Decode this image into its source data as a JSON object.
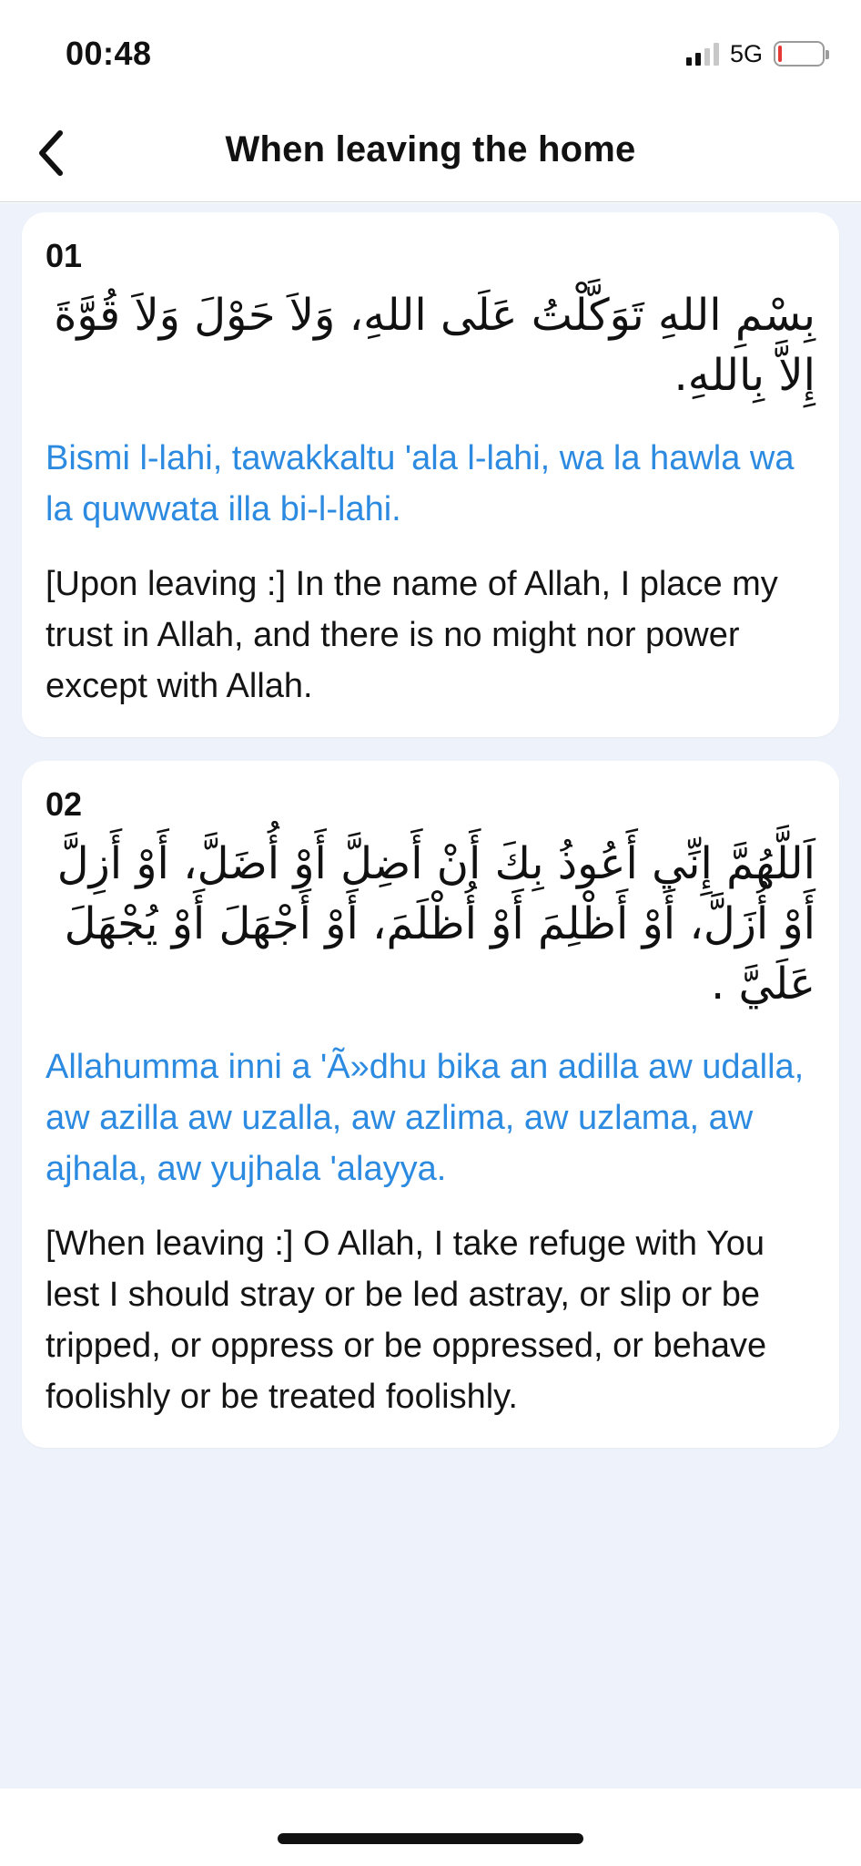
{
  "status_bar": {
    "time": "00:48",
    "network": "5G",
    "signal_icon": "signal-bars-icon",
    "battery_icon": "battery-low-icon",
    "battery_color": "#e53935"
  },
  "nav": {
    "back_icon": "chevron-left-icon",
    "title": "When leaving the home"
  },
  "colors": {
    "accent": "#2c8be0",
    "background": "#eef3fb",
    "card": "#ffffff"
  },
  "cards": [
    {
      "number": "01",
      "arabic": "بِسْمِ اللهِ تَوَكَّلْتُ عَلَى اللهِ، وَلاَ حَوْلَ وَلاَ قُوَّةَ إِلاَّ بِاللهِ.",
      "transliteration": "Bismi l-lahi, tawakkaltu 'ala l-lahi, wa la hawla wa la quwwata illa bi-l-lahi.",
      "translation": "[Upon leaving :] In the name of Allah, I place my trust in Allah, and there is no might nor power except with Allah."
    },
    {
      "number": "02",
      "arabic": "اَللَّهُمَّ إِنِّي أَعُوذُ بِكَ أَنْ أَضِلَّ أَوْ أُضَلَّ، أَوْ أَزِلَّ أَوْ أُزَلَّ، أَوْ أَظْلِمَ أَوْ أُظْلَمَ، أَوْ أَجْهَلَ أَوْ يُجْهَلَ عَلَيَّ .",
      "transliteration": "Allahumma inni a 'Ã»dhu bika an adilla aw udalla, aw azilla aw uzalla, aw azlima, aw uzlama, aw ajhala, aw yujhala 'alayya.",
      "translation": "[When leaving :] O Allah, I take refuge with You lest I should stray or be led astray, or slip or be tripped, or oppress or be oppressed, or behave foolishly or be treated foolishly."
    }
  ]
}
